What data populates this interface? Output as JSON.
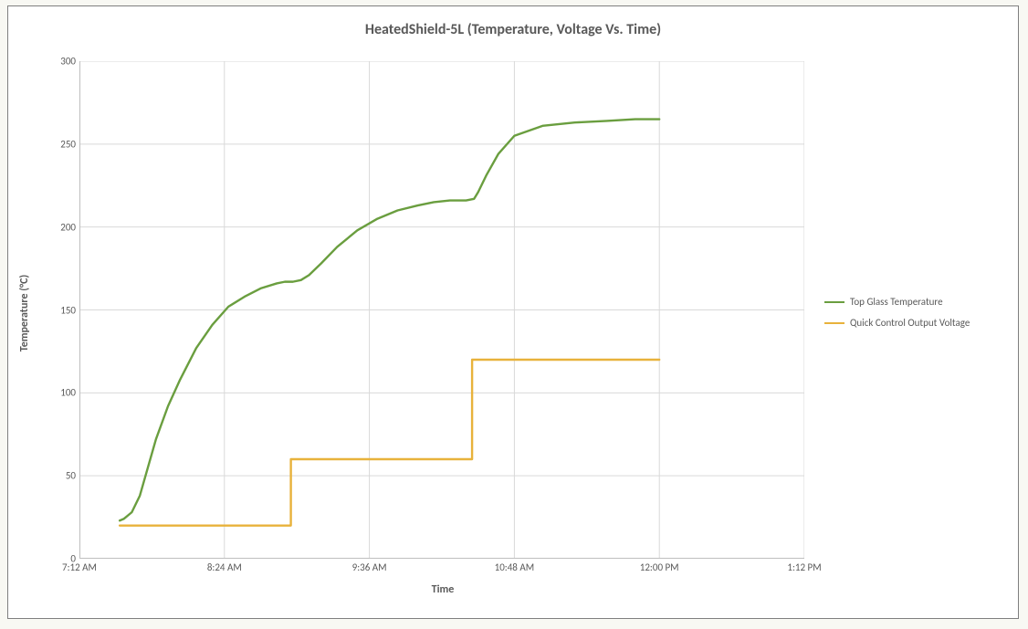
{
  "title": "HeatedShield-5L (Temperature, Voltage Vs. Time)",
  "xlabel": "Time",
  "ylabel": "Temperature (°C)",
  "legend": {
    "items": [
      {
        "name": "Top Glass Temperature",
        "color": "#6a9e3f"
      },
      {
        "name": "Quick Control Output Voltage",
        "color": "#e8b23b"
      }
    ]
  },
  "x_ticks": [
    "7:12 AM",
    "8:24 AM",
    "9:36 AM",
    "10:48 AM",
    "12:00 PM",
    "1:12 PM"
  ],
  "y_ticks": [
    "0",
    "50",
    "100",
    "150",
    "200",
    "250",
    "300"
  ],
  "chart_data": {
    "type": "line",
    "xlim_minutes": [
      432,
      792
    ],
    "ylim": [
      0,
      300
    ],
    "grid": true,
    "x_tick_minutes": [
      432,
      504,
      576,
      648,
      720,
      792
    ],
    "x_tick_labels": [
      "7:12 AM",
      "8:24 AM",
      "9:36 AM",
      "10:48 AM",
      "12:00 PM",
      "1:12 PM"
    ],
    "series": [
      {
        "name": "Top Glass Temperature",
        "color": "#6a9e3f",
        "x_minutes": [
          452,
          454,
          458,
          462,
          466,
          470,
          476,
          482,
          490,
          498,
          506,
          514,
          522,
          530,
          534,
          538,
          542,
          546,
          552,
          560,
          570,
          580,
          590,
          600,
          608,
          616,
          624,
          628,
          630,
          634,
          640,
          648,
          662,
          678,
          694,
          708,
          720
        ],
        "values": [
          23,
          24,
          28,
          38,
          55,
          72,
          92,
          108,
          127,
          141,
          152,
          158,
          163,
          166,
          167,
          167,
          168,
          171,
          178,
          188,
          198,
          205,
          210,
          213,
          215,
          216,
          216,
          217,
          221,
          231,
          244,
          255,
          261,
          263,
          264,
          265,
          265
        ]
      },
      {
        "name": "Quick Control Output Voltage",
        "color": "#e8b23b",
        "x_minutes": [
          452,
          537,
          537.01,
          627,
          627.01,
          720
        ],
        "values": [
          20,
          20,
          60,
          60,
          120,
          120
        ]
      }
    ]
  }
}
